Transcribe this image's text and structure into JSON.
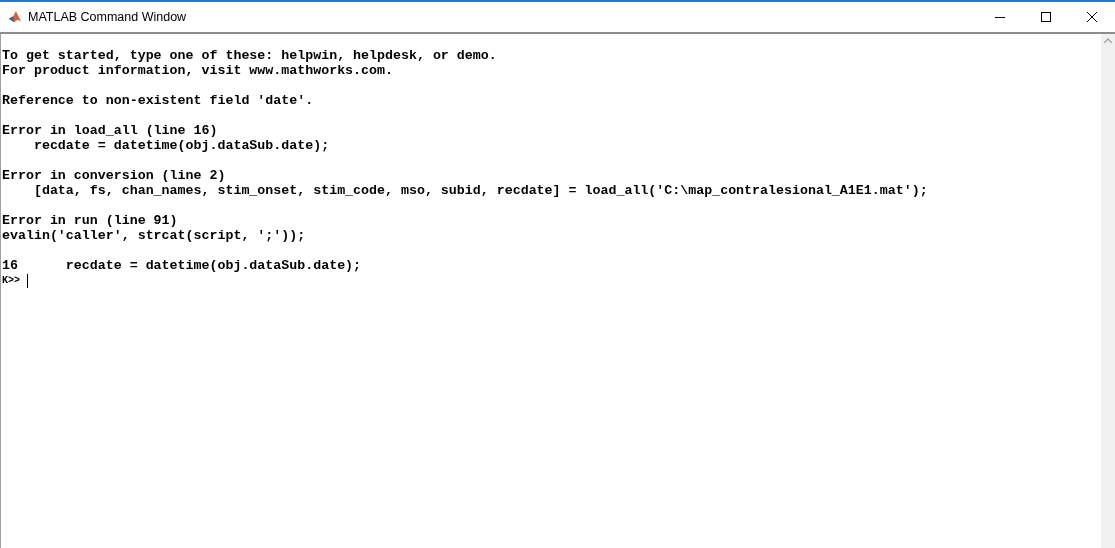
{
  "window": {
    "title": "MATLAB Command Window"
  },
  "output_blocks": [
    [
      "To get started, type one of these: helpwin, helpdesk, or demo.",
      "For product information, visit www.mathworks.com."
    ],
    [
      "Reference to non-existent field 'date'."
    ],
    [
      "Error in load_all (line 16)",
      "    recdate = datetime(obj.dataSub.date);"
    ],
    [
      "Error in conversion (line 2)",
      "    [data, fs, chan_names, stim_onset, stim_code, mso, subid, recdate] = load_all('C:\\map_contralesional_A1E1.mat');"
    ],
    [
      "Error in run (line 91)",
      "evalin('caller', strcat(script, ';'));"
    ],
    [
      "16      recdate = datetime(obj.dataSub.date);"
    ]
  ],
  "prompt": "K>>"
}
